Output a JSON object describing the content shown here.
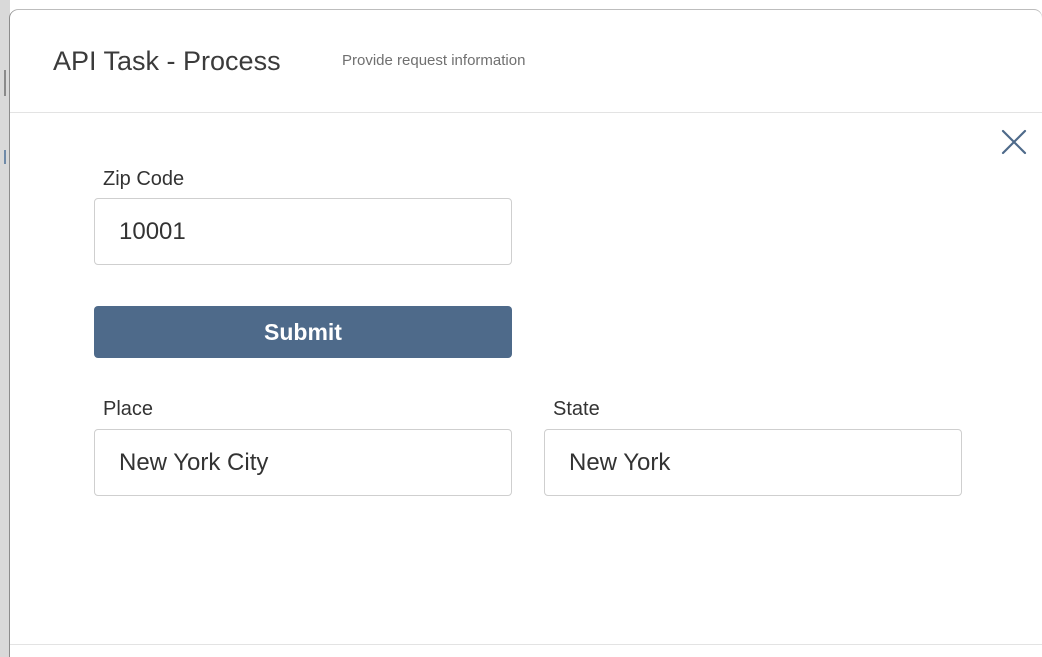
{
  "dialog": {
    "title": "API Task - Process",
    "subtitle": "Provide request information",
    "close_icon": "close-icon"
  },
  "form": {
    "zip": {
      "label": "Zip Code",
      "value": "10001"
    },
    "submit_label": "Submit",
    "place": {
      "label": "Place",
      "value": "New York City"
    },
    "state": {
      "label": "State",
      "value": "New York"
    }
  },
  "colors": {
    "submit_bg": "#4e6a8a",
    "close_icon": "#4e6a8a"
  }
}
